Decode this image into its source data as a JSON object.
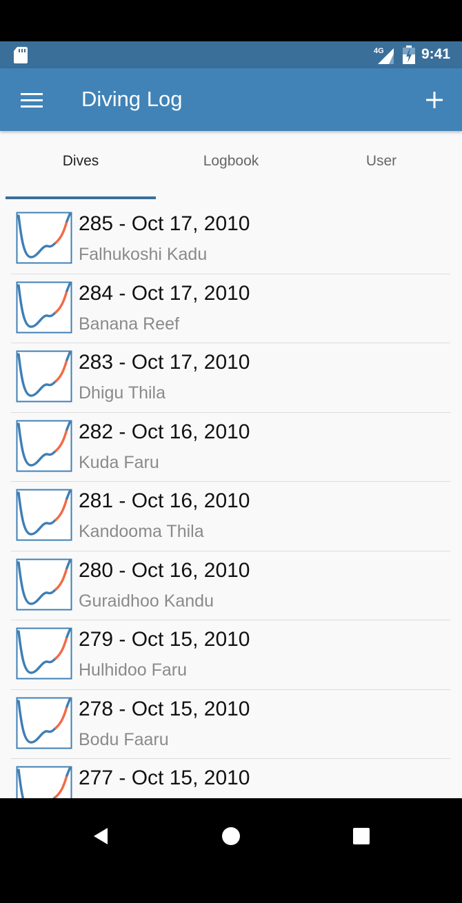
{
  "status_bar": {
    "time": "9:41",
    "network": "4G",
    "icons": [
      "sd-card-icon",
      "cell-signal-icon",
      "battery-icon"
    ]
  },
  "app_bar": {
    "title": "Diving Log",
    "left_icon": "menu-icon",
    "right_icon": "add-icon"
  },
  "tabs": [
    {
      "label": "Dives",
      "active": true
    },
    {
      "label": "Logbook",
      "active": false
    },
    {
      "label": "User",
      "active": false
    }
  ],
  "dives": [
    {
      "title": "285 - Oct 17, 2010",
      "site": "Falhukoshi Kadu"
    },
    {
      "title": "284 - Oct 17, 2010",
      "site": "Banana Reef"
    },
    {
      "title": "283 - Oct 17, 2010",
      "site": "Dhigu Thila"
    },
    {
      "title": "282 - Oct 16, 2010",
      "site": "Kuda Faru"
    },
    {
      "title": "281 - Oct 16, 2010",
      "site": "Kandooma Thila"
    },
    {
      "title": "280 - Oct 16, 2010",
      "site": "Guraidhoo Kandu"
    },
    {
      "title": "279 - Oct 15, 2010",
      "site": "Hulhidoo Faru"
    },
    {
      "title": "278 - Oct 15, 2010",
      "site": "Bodu Faaru"
    },
    {
      "title": "277 - Oct 15, 2010",
      "site": ""
    }
  ],
  "nav_bar": {
    "icons": [
      "back-icon",
      "home-icon",
      "recents-icon"
    ]
  },
  "colors": {
    "status_bar": "#3a6f9a",
    "app_bar": "#4183b6",
    "profile_line": "#3f7fb5",
    "profile_ascent": "#f26b45"
  }
}
